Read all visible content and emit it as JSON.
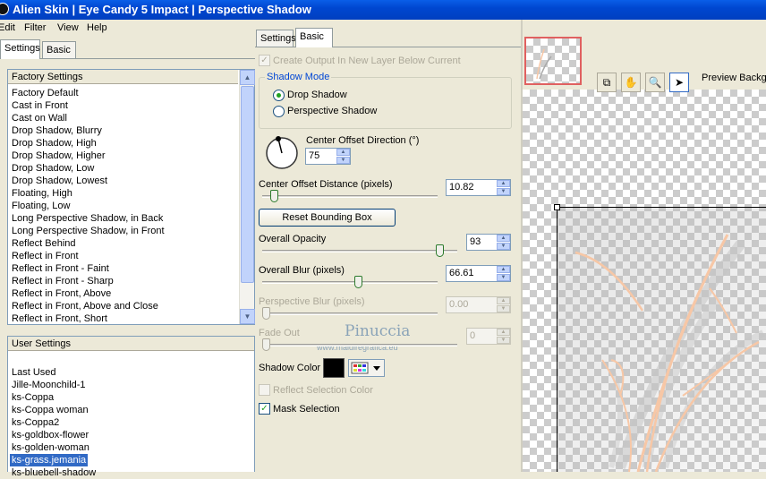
{
  "window": {
    "title": "Alien Skin  |  Eye Candy 5 Impact  |  Perspective Shadow"
  },
  "menu": [
    "Edit",
    "Filter",
    "View",
    "Help"
  ],
  "left_tabs": [
    "Settings",
    "Basic"
  ],
  "factory_settings": {
    "header": "Factory Settings",
    "items": [
      "Factory Default",
      "Cast in Front",
      "Cast on Wall",
      "Drop Shadow, Blurry",
      "Drop Shadow, High",
      "Drop Shadow, Higher",
      "Drop Shadow, Low",
      "Drop Shadow, Lowest",
      "Floating, High",
      "Floating, Low",
      "Long Perspective Shadow, in Back",
      "Long Perspective Shadow, in Front",
      "Reflect Behind",
      "Reflect in Front",
      "Reflect in Front - Faint",
      "Reflect in Front - Sharp",
      "Reflect in Front, Above",
      "Reflect in Front, Above and Close",
      "Reflect in Front, Short"
    ]
  },
  "user_settings": {
    "header": "User Settings",
    "items": [
      "Last Used",
      "Jille-Moonchild-1",
      "ks-Coppa",
      "ks-Coppa woman",
      "ks-Coppa2",
      "ks-goldbox-flower",
      "ks-golden-woman",
      "ks-grass.jemania",
      "ks-bluebell-shadow"
    ],
    "selected_index": 7
  },
  "mid_tabs": [
    "Settings",
    "Basic"
  ],
  "basic": {
    "create_output_label": "Create Output In New Layer Below Current",
    "shadow_mode_label": "Shadow Mode",
    "mode_options": [
      "Drop Shadow",
      "Perspective Shadow"
    ],
    "mode_selected": 0,
    "direction_label": "Center Offset Direction (°)",
    "direction_value": "75",
    "distance_label": "Center Offset Distance (pixels)",
    "distance_value": "10.82",
    "distance_level": 0.05,
    "reset_label": "Reset Bounding Box",
    "opacity_label": "Overall Opacity",
    "opacity_value": "93",
    "opacity_level": 0.93,
    "blur_label": "Overall Blur (pixels)",
    "blur_value": "66.61",
    "blur_level": 0.55,
    "persp_blur_label": "Perspective Blur (pixels)",
    "persp_blur_value": "0.00",
    "fade_label": "Fade Out",
    "fade_value": "0",
    "shadow_color_label": "Shadow Color",
    "shadow_color": "#000000",
    "reflect_label": "Reflect Selection Color",
    "mask_label": "Mask Selection"
  },
  "watermark": {
    "name": "Pinuccia",
    "url": "www.maidiregrafica.eu"
  },
  "preview": {
    "label": "Preview Backg",
    "tools": [
      "toggle-preview-icon",
      "hand-icon",
      "zoom-icon",
      "arrow-icon"
    ]
  },
  "colors": {
    "accent": "#316ac5",
    "shadow_gray": "#b4b4b4",
    "grass": "#f7c7a6"
  }
}
